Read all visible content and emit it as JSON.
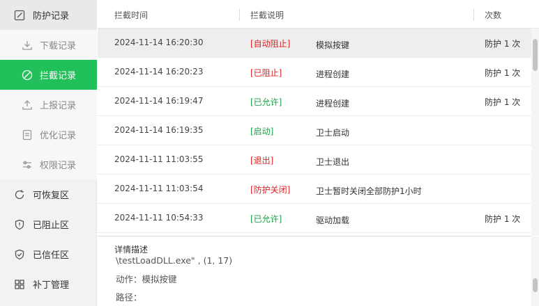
{
  "sidebar": {
    "items": [
      {
        "label": "防护记录",
        "icon": "edit-icon",
        "kind": "top parent"
      },
      {
        "label": "下载记录",
        "icon": "download-icon",
        "kind": "sub"
      },
      {
        "label": "拦截记录",
        "icon": "block-icon",
        "kind": "sub active"
      },
      {
        "label": "上报记录",
        "icon": "upload-icon",
        "kind": "sub"
      },
      {
        "label": "优化记录",
        "icon": "document-icon",
        "kind": "sub"
      },
      {
        "label": "权限记录",
        "icon": "sliders-icon",
        "kind": "sub"
      },
      {
        "label": "可恢复区",
        "icon": "restore-icon",
        "kind": "top"
      },
      {
        "label": "已阻止区",
        "icon": "shield-alert-icon",
        "kind": "top"
      },
      {
        "label": "已信任区",
        "icon": "shield-check-icon",
        "kind": "top"
      },
      {
        "label": "补丁管理",
        "icon": "grid-icon",
        "kind": "top"
      }
    ]
  },
  "table": {
    "headers": {
      "time": "拦截时间",
      "desc": "拦截说明",
      "count": "次数"
    },
    "rows": [
      {
        "time": "2024-11-14 16:20:30",
        "tag": "[自动阻止]",
        "tag_color": "red",
        "desc": "模拟按键",
        "count": "防护 1 次"
      },
      {
        "time": "2024-11-14 16:20:23",
        "tag": "[已阻止]",
        "tag_color": "red",
        "desc": "进程创建",
        "count": "防护 1 次"
      },
      {
        "time": "2024-11-14 16:19:47",
        "tag": "[已允许]",
        "tag_color": "green",
        "desc": "进程创建",
        "count": "防护 1 次"
      },
      {
        "time": "2024-11-14 16:19:35",
        "tag": "[启动]",
        "tag_color": "green",
        "desc": "卫士启动",
        "count": ""
      },
      {
        "time": "2024-11-11 11:03:55",
        "tag": "[退出]",
        "tag_color": "red",
        "desc": "卫士退出",
        "count": ""
      },
      {
        "time": "2024-11-11 11:03:54",
        "tag": "[防护关闭]",
        "tag_color": "red",
        "desc": "卫士暂时关闭全部防护1小时",
        "count": ""
      },
      {
        "time": "2024-11-11 10:54:33",
        "tag": "[已允许]",
        "tag_color": "green",
        "desc": "驱动加载",
        "count": "防护 1 次"
      }
    ]
  },
  "detail": {
    "title": "详情描述",
    "lines": [
      "\\testLoadDLL.exe\" , (1, 17)",
      "动作：模拟按键",
      "路径："
    ]
  }
}
